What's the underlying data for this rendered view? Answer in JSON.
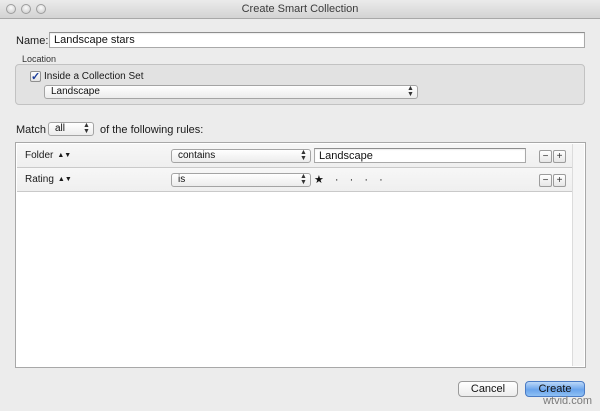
{
  "window": {
    "title": "Create Smart Collection"
  },
  "name_field": {
    "label": "Name:",
    "value": "Landscape stars"
  },
  "location": {
    "header": "Location",
    "inside_set_label": "Inside a Collection Set",
    "inside_set_checked": true,
    "set_value": "Landscape"
  },
  "match": {
    "prefix": "Match",
    "mode": "all",
    "suffix": "of the following rules:"
  },
  "rules": [
    {
      "field": "Folder",
      "operator": "contains",
      "value": "Landscape",
      "remove": "−",
      "add": "+"
    },
    {
      "field": "Rating",
      "operator": "is",
      "value": "★ · · · ·",
      "rating_value": 1,
      "remove": "−",
      "add": "+"
    }
  ],
  "buttons": {
    "cancel": "Cancel",
    "create": "Create"
  },
  "watermark": "wtvid.com",
  "icons": {
    "checkmark": "checkmark-icon",
    "popup_arrows": "updown-arrows-icon",
    "window_controls": [
      "close-icon",
      "minimize-icon",
      "zoom-icon"
    ]
  }
}
